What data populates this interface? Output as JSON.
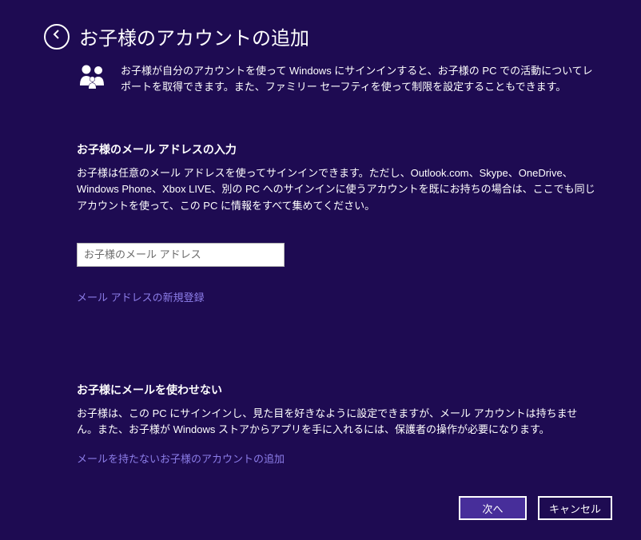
{
  "header": {
    "title": "お子様のアカウントの追加"
  },
  "intro": {
    "text": "お子様が自分のアカウントを使って Windows にサインインすると、お子様の PC での活動についてレポートを取得できます。また、ファミリー セーフティを使って制限を設定することもできます。"
  },
  "section_email": {
    "title": "お子様のメール アドレスの入力",
    "text": "お子様は任意のメール アドレスを使ってサインインできます。ただし、Outlook.com、Skype、OneDrive、Windows Phone、Xbox LIVE、別の PC へのサインインに使うアカウントを既にお持ちの場合は、ここでも同じアカウントを使って、この PC に情報をすべて集めてください。",
    "input_placeholder": "お子様のメール アドレス",
    "input_value": "",
    "link_label": "メール アドレスの新規登録"
  },
  "section_noemail": {
    "title": "お子様にメールを使わせない",
    "text": "お子様は、この PC にサインインし、見た目を好きなように設定できますが、メール アカウントは持ちません。また、お子様が Windows ストアからアプリを手に入れるには、保護者の操作が必要になります。",
    "link_label": "メールを持たないお子様のアカウントの追加"
  },
  "footer": {
    "next_label": "次へ",
    "cancel_label": "キャンセル"
  }
}
